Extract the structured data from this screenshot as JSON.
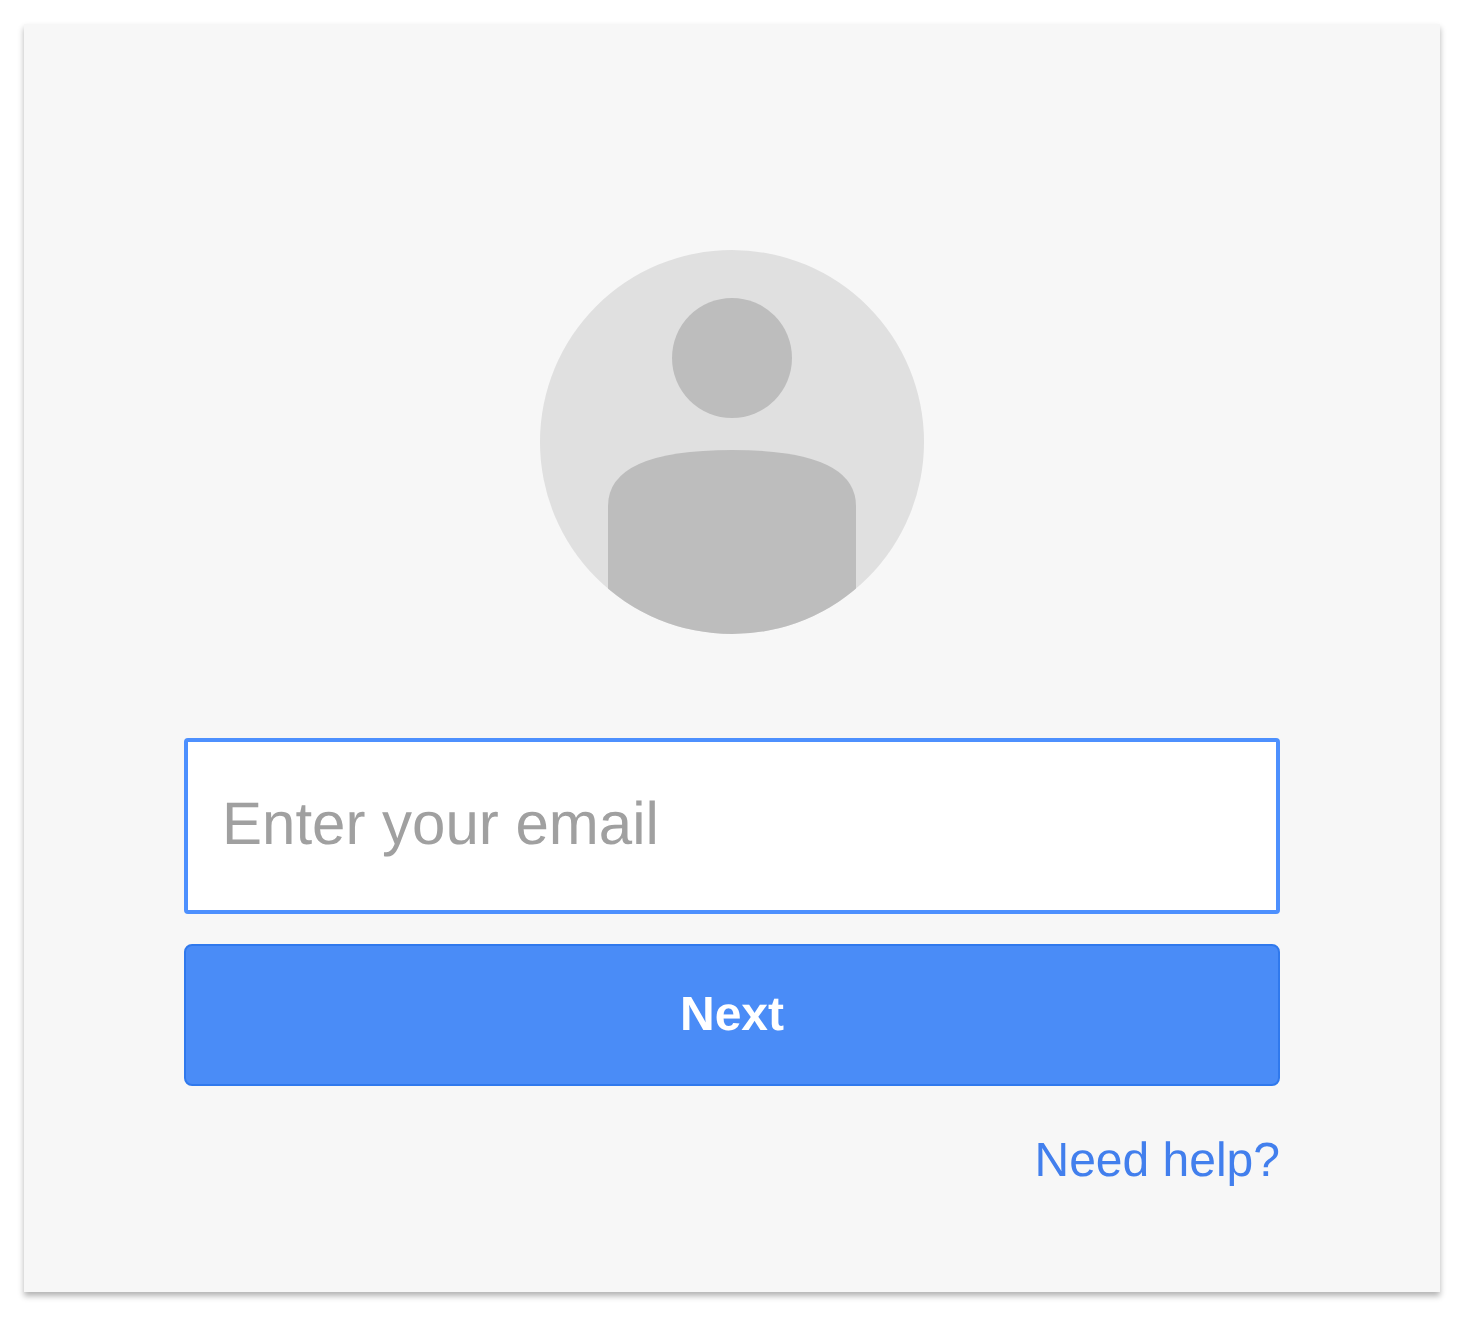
{
  "email_field": {
    "placeholder": "Enter your email",
    "focused": true
  },
  "next_button": {
    "label": "Next"
  },
  "help_link": {
    "label": "Need help?"
  }
}
